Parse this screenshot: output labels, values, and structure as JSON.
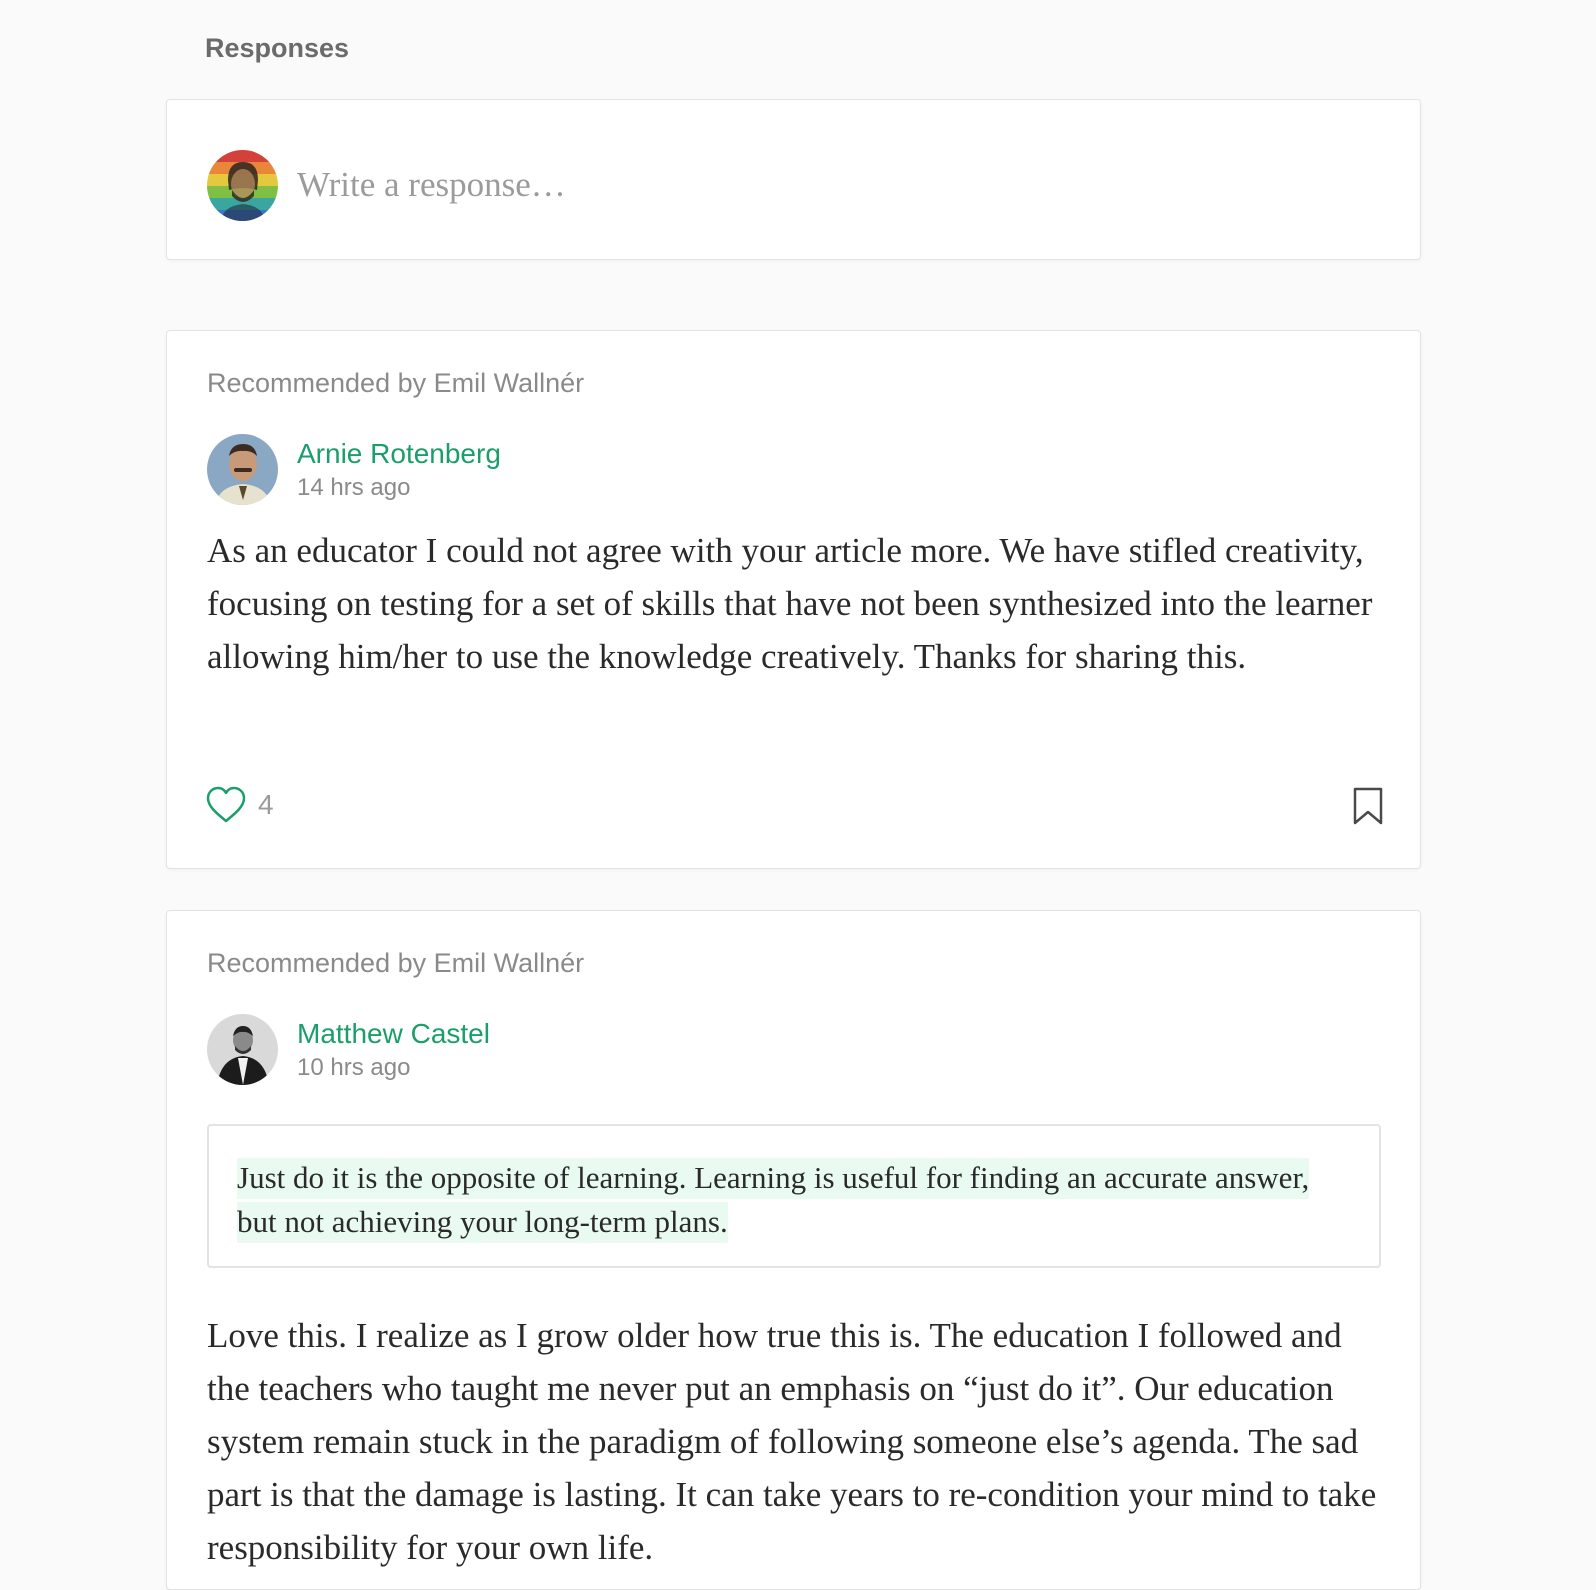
{
  "section": {
    "title": "Responses"
  },
  "compose": {
    "placeholder": "Write a response…"
  },
  "responses": [
    {
      "recommended_by": "Recommended by Emil Wallnér",
      "author": "Arnie Rotenberg",
      "time": "14 hrs ago",
      "body": "As an educator I could not agree with your article more. We have stifled creativity, focusing on testing for a set of skills that have not been synthesized into the learner allowing him/her to use the knowledge creatively. Thanks for sharing this.",
      "likes": "4"
    },
    {
      "recommended_by": "Recommended by Emil Wallnér",
      "author": "Matthew Castel",
      "time": "10 hrs ago",
      "quote": "Just do it is the opposite of learning. Learning is useful for finding an accurate answer, but not achieving your long-term plans.",
      "body": "Love this. I realize as I grow older how true this is. The education I followed and the teachers who taught me never put an emphasis on “just do it”. Our education system remain stuck in the paradigm of following someone else’s agenda. The sad part is that the damage is lasting. It can take years to re-condition your mind to take responsibility for your own life."
    }
  ],
  "icons": {
    "like": "heart-icon",
    "save": "bookmark-icon"
  },
  "colors": {
    "accent": "#1a9f6b",
    "highlight": "#e9fbf1",
    "background": "#fafafa"
  }
}
